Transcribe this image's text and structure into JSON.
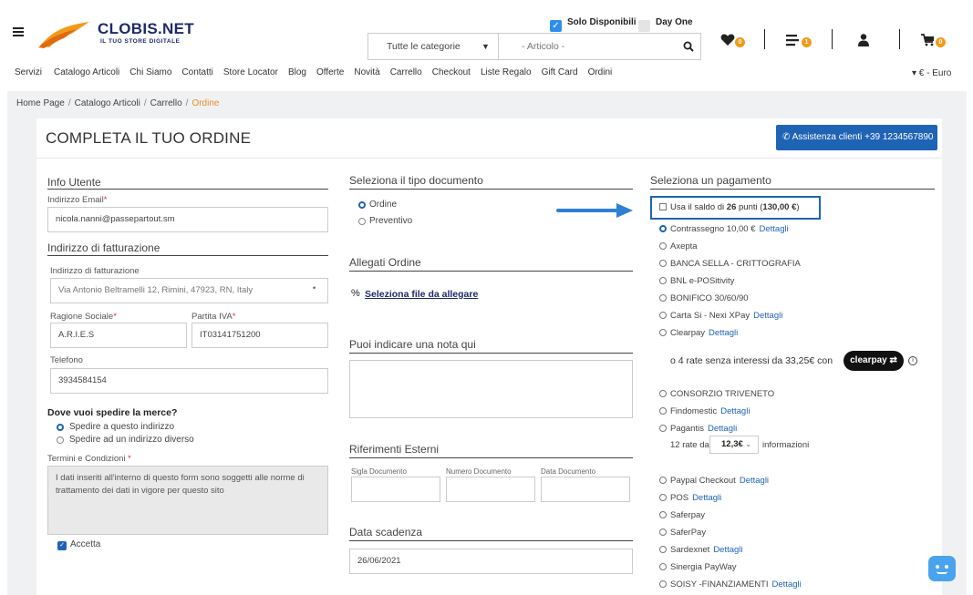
{
  "header": {
    "logo_title": "CLOBIS.NET",
    "logo_subtitle": "IL TUO STORE DIGITALE",
    "filter_available": "Solo Disponibili",
    "filter_dayone": "Day One",
    "category_select": "Tutte le categorie",
    "search_placeholder": "- Articolo -",
    "wishlist_count": "0",
    "compare_count": "1",
    "cart_count": "0"
  },
  "nav": {
    "items": [
      "Servizi",
      "Catalogo Articoli",
      "Chi Siamo",
      "Contatti",
      "Store Locator",
      "Blog",
      "Offerte",
      "Novità",
      "Carrello",
      "Checkout",
      "Liste Regalo",
      "Gift Card",
      "Ordini"
    ],
    "currency": "▾ € - Euro"
  },
  "breadcrumb": {
    "items": [
      "Home Page",
      "Catalogo Articoli",
      "Carrello"
    ],
    "active": "Ordine"
  },
  "page": {
    "title": "COMPLETA IL TUO ORDINE",
    "assist_button": "Assistenza clienti +39 1234567890"
  },
  "user_info": {
    "section_title": "Info Utente",
    "email_label": "Indirizzo Email",
    "email_value": "nicola.nanni@passepartout.sm",
    "billing_section": "Indirizzo di fatturazione",
    "billing_label": "Indirizzo di fatturazione",
    "billing_value": "Via Antonio Beltramelli 12, Rimini, 47923, RN, Italy",
    "company_label": "Ragione Sociale",
    "company_value": "A.R.I.E.S",
    "vat_label": "Partita IVA",
    "vat_value": "IT03141751200",
    "phone_label": "Telefono",
    "phone_value": "3934584154",
    "shipping_question": "Dove vuoi spedire la merce?",
    "ship_option_1": "Spedire a questo indirizzo",
    "ship_option_2": "Spedire ad un indirizzo diverso",
    "terms_label": "Termini e Condizioni",
    "terms_text": "I dati inseriti all'interno di questo form sono soggetti alle norme di trattamento dei dati in vigore per questo sito",
    "accept_label": "Accetta"
  },
  "document": {
    "section_title": "Seleziona il tipo documento",
    "option_order": "Ordine",
    "option_quote": "Preventivo",
    "attachments_title": "Allegati Ordine",
    "attach_link": "Seleziona file da allegare",
    "note_title": "Puoi indicare una nota qui",
    "refs_title": "Riferimenti Esterni",
    "ref_series": "Sigla Documento",
    "ref_number": "Numero Documento",
    "ref_date": "Data Documento",
    "due_title": "Data scadenza",
    "due_value": "26/06/2021"
  },
  "payment": {
    "section_title": "Seleziona un pagamento",
    "points_prefix": "Usa il saldo di ",
    "points_count": "26",
    "points_mid": " punti (",
    "points_value": "130,00 €",
    "points_suffix": ")",
    "methods": [
      {
        "name": "Contrassegno 10,00 €",
        "details": "Dettagli"
      },
      {
        "name": "Axepta"
      },
      {
        "name": "BANCA SELLA - CRITTOGRAFIA"
      },
      {
        "name": "BNL e-POSitivity"
      },
      {
        "name": "BONIFICO 30/60/90"
      },
      {
        "name": "Carta Si - Nexi XPay",
        "details": "Dettagli"
      },
      {
        "name": "Clearpay",
        "details": "Dettagli"
      }
    ],
    "clearpay_text": "o 4 rate senza interessi da 33,25€ con",
    "clearpay_badge": "clearpay",
    "methods_2": [
      {
        "name": "CONSORZIO TRIVENETO"
      },
      {
        "name": "Findomestic",
        "details": "Dettagli"
      },
      {
        "name": "Pagantis",
        "details": "Dettagli"
      }
    ],
    "rate_prefix": "12 rate da",
    "rate_value": "12,3€",
    "rate_suffix": "informazioni",
    "methods_3": [
      {
        "name": "Paypal Checkout",
        "details": "Dettagli"
      },
      {
        "name": "POS",
        "details": "Dettagli"
      },
      {
        "name": "Saferpay"
      },
      {
        "name": "SaferPay"
      },
      {
        "name": "Sardexnet",
        "details": "Dettagli"
      },
      {
        "name": "Sinergia PayWay"
      },
      {
        "name": "SOISY -FINANZIAMENTI",
        "details": "Dettagli"
      }
    ]
  },
  "colors": {
    "accent": "#1f63b5",
    "brand": "#1d2a6b",
    "badge": "#f29a1b",
    "breadcrumb_active": "#ef8a2c"
  }
}
